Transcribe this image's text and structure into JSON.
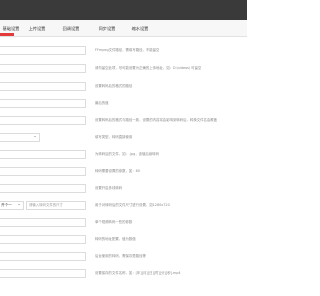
{
  "tabs": [
    {
      "label": "基础设置"
    },
    {
      "label": "上传设置"
    },
    {
      "label": "回调设置"
    },
    {
      "label": "同步设置"
    },
    {
      "label": "缩水设置"
    }
  ],
  "fields": [
    {
      "description": "FFmpeg文件路径，需填写路径，不能留空"
    },
    {
      "description": "请勿留空此项，尽可能设置为正确的上传地址，如：D:\\videos\\ 可留空"
    },
    {
      "description": "设置转码后的格式的路径"
    },
    {
      "description": "最后的值"
    },
    {
      "description": "设置转码后的格式与路径一致，设置的内容将会影响到转码后，转换文件名会覆盖"
    },
    {
      "select_value": "",
      "description": "填写类型，转码直接使用"
    },
    {
      "description": "为转码后的文件，如：.jpg，该值后续转码"
    },
    {
      "description": "转码需要设置的参数，如：60"
    },
    {
      "description": "设置开启多线转码"
    },
    {
      "select_value": "开个一",
      "input_placeholder": "请输入转码文件的尺寸",
      "description": "用于对转码后的文件尺寸进行设置，如1280x720"
    },
    {
      "description": "单个视频转码一些的参数"
    },
    {
      "description": "转码的地址配置，值为数值"
    },
    {
      "description": "后台使用的转码，需保存是路径等"
    },
    {
      "description": "设置保存的文件名称，如：[年][月][日][时][分][秒].mp4"
    }
  ]
}
